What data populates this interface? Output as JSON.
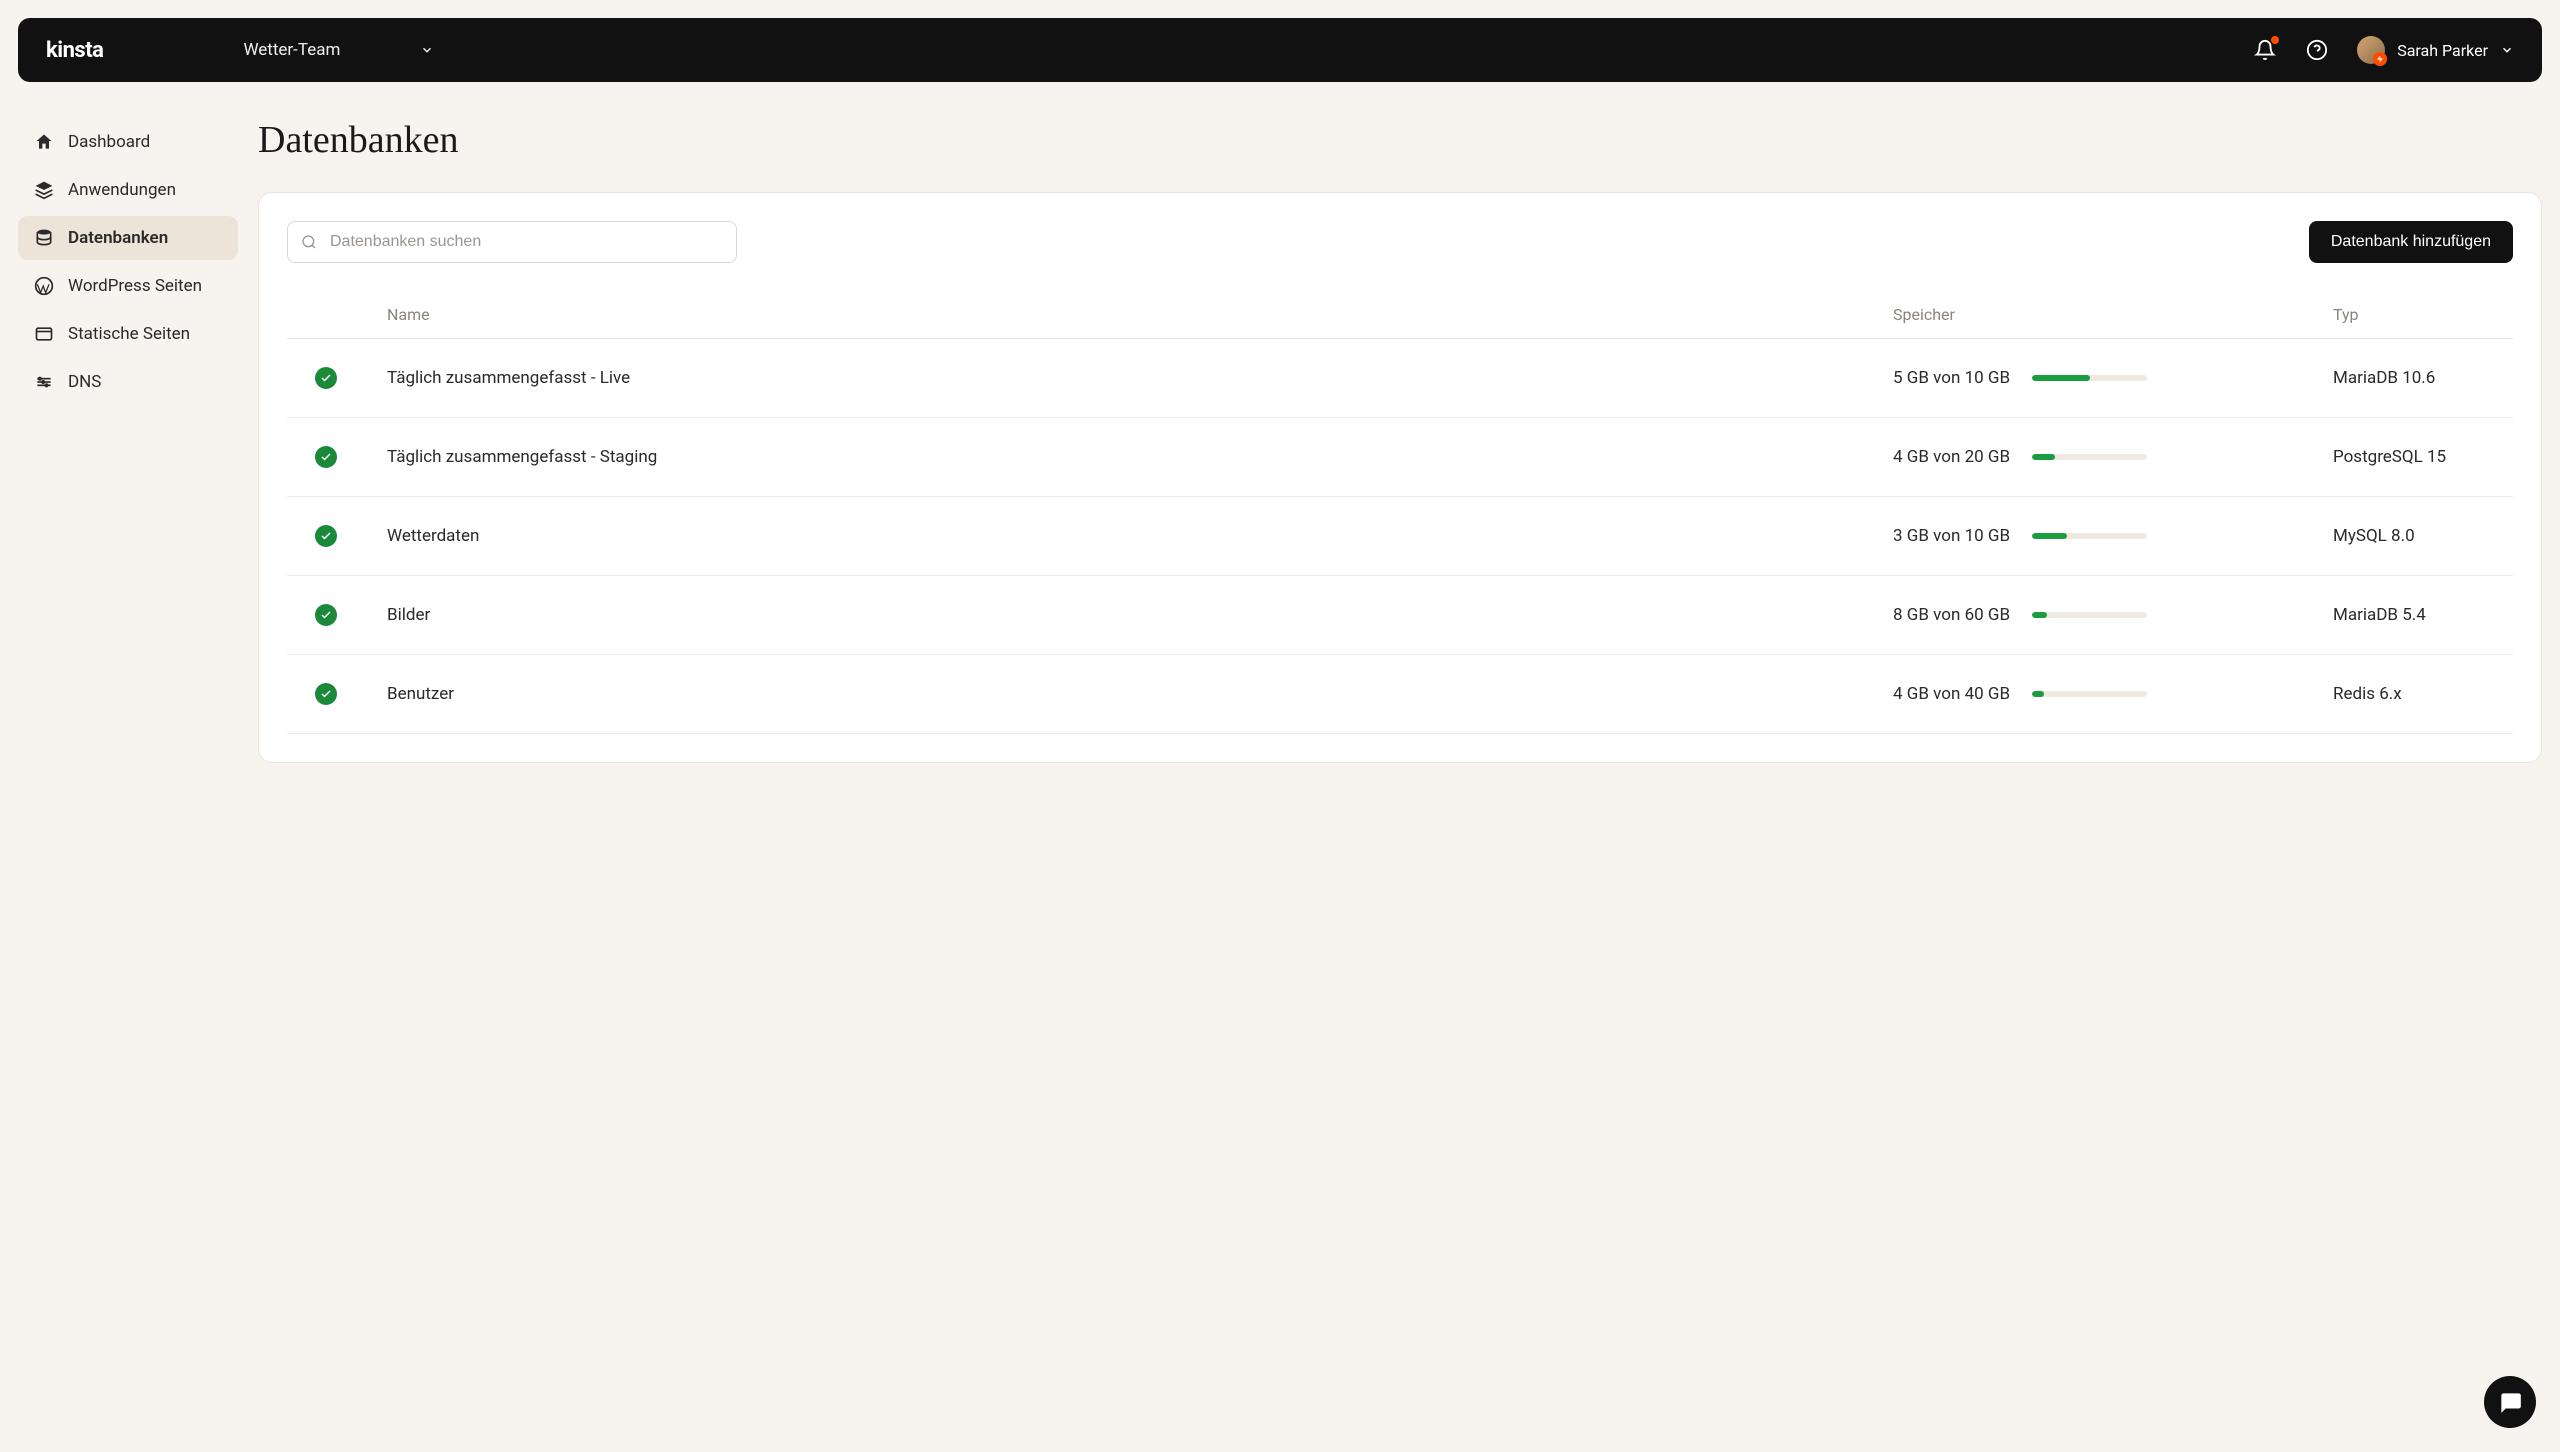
{
  "header": {
    "logo": "kinsta",
    "team": "Wetter-Team",
    "user": "Sarah Parker"
  },
  "sidebar": {
    "items": [
      {
        "label": "Dashboard",
        "icon": "home",
        "active": false
      },
      {
        "label": "Anwendungen",
        "icon": "layers",
        "active": false
      },
      {
        "label": "Datenbanken",
        "icon": "database",
        "active": true
      },
      {
        "label": "WordPress Seiten",
        "icon": "wp",
        "active": false
      },
      {
        "label": "Statische Seiten",
        "icon": "window",
        "active": false
      },
      {
        "label": "DNS",
        "icon": "dns",
        "active": false
      }
    ]
  },
  "page": {
    "title": "Datenbanken",
    "search_placeholder": "Datenbanken suchen",
    "add_button": "Datenbank hinzufügen"
  },
  "table": {
    "columns": {
      "name": "Name",
      "storage": "Speicher",
      "type": "Typ"
    },
    "rows": [
      {
        "name": "Täglich zusammengefasst - Live",
        "storage_text": "5 GB von 10 GB",
        "pct": 50,
        "type": "MariaDB 10.6"
      },
      {
        "name": "Täglich zusammengefasst - Staging",
        "storage_text": "4 GB von 20 GB",
        "pct": 20,
        "type": "PostgreSQL 15"
      },
      {
        "name": "Wetterdaten",
        "storage_text": "3 GB von 10 GB",
        "pct": 30,
        "type": "MySQL 8.0"
      },
      {
        "name": "Bilder",
        "storage_text": "8 GB von 60 GB",
        "pct": 13,
        "type": "MariaDB 5.4"
      },
      {
        "name": "Benutzer",
        "storage_text": "4 GB von 40 GB",
        "pct": 10,
        "type": "Redis 6.x"
      }
    ]
  }
}
